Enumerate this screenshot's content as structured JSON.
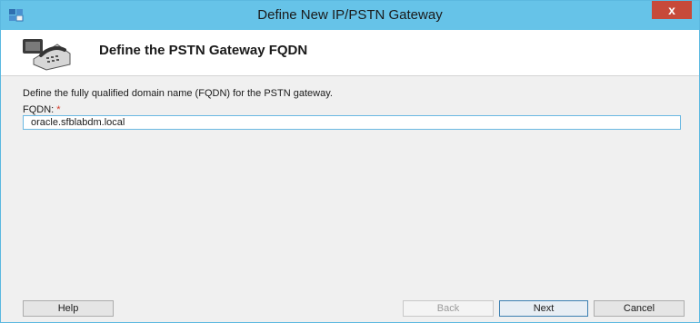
{
  "window": {
    "title": "Define New IP/PSTN Gateway",
    "close_glyph": "x"
  },
  "header": {
    "title": "Define the PSTN Gateway FQDN",
    "icon": "phone-icon"
  },
  "form": {
    "description": "Define the fully qualified domain name (FQDN) for the PSTN gateway.",
    "fqdn_label": "FQDN:",
    "required_marker": "*",
    "fqdn_value": "oracle.sfblabdm.local"
  },
  "buttons": {
    "help": "Help",
    "back": "Back",
    "next": "Next",
    "cancel": "Cancel"
  },
  "colors": {
    "titlebar": "#66c3e8",
    "close": "#c74a3a",
    "required": "#d33c2a"
  }
}
